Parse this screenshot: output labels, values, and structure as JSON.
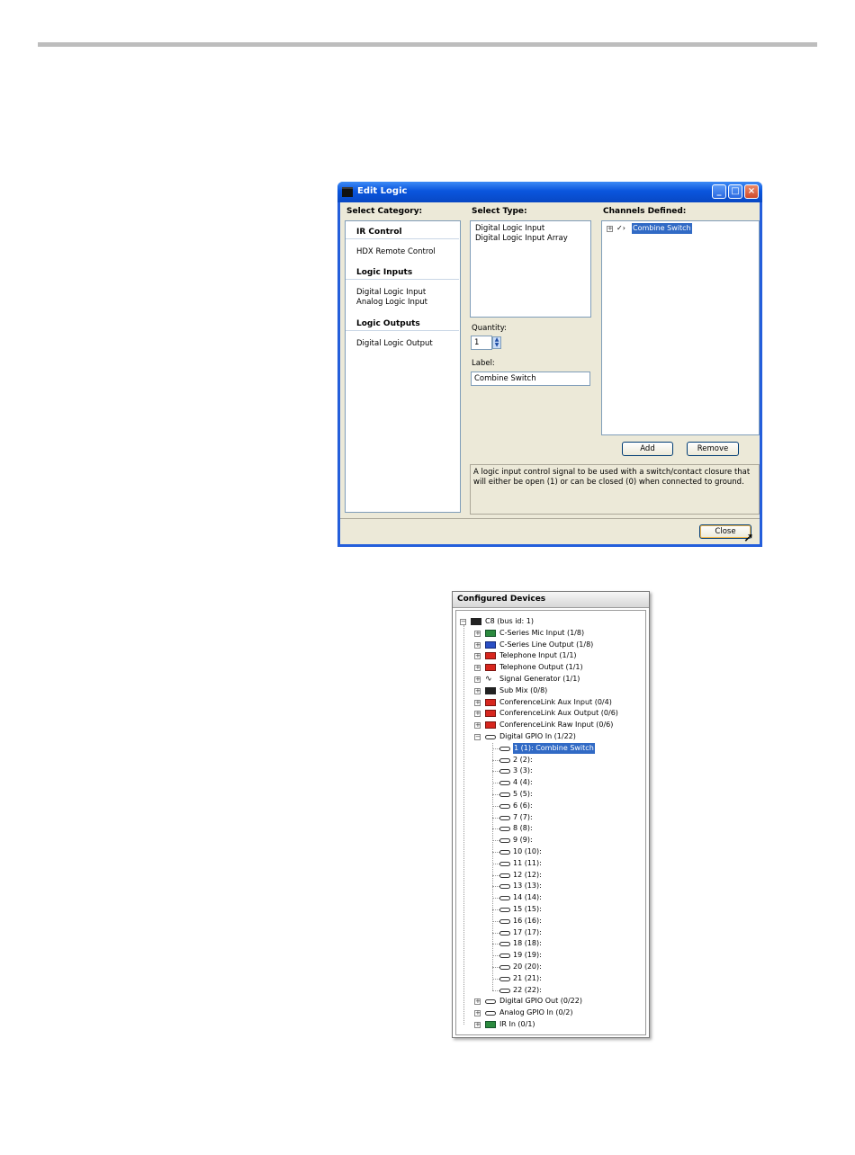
{
  "window": {
    "title": "Edit Logic",
    "headers": {
      "category": "Select Category:",
      "type": "Select Type:",
      "channels": "Channels Defined:"
    },
    "categories": [
      {
        "heading": "IR Control",
        "items": [
          "HDX Remote Control"
        ]
      },
      {
        "heading": "Logic Inputs",
        "items": [
          "Digital Logic Input",
          "Analog Logic Input"
        ]
      },
      {
        "heading": "Logic Outputs",
        "items": [
          "Digital Logic Output"
        ]
      }
    ],
    "types": [
      "Digital Logic Input",
      "Digital Logic Input Array"
    ],
    "quantity_label": "Quantity:",
    "quantity_value": "1",
    "label_label": "Label:",
    "label_value": "Combine Switch",
    "channel_item": "Combine Switch",
    "add_label": "Add",
    "remove_label": "Remove",
    "description": "A logic input control signal to be used with a switch/contact closure that will either be open (1) or can be closed (0) when connected to ground.",
    "close_label": "Close"
  },
  "devices": {
    "title": "Configured Devices",
    "root": "C8 (bus id: 1)",
    "items": [
      {
        "label": "C-Series Mic Input (1/8)",
        "icon": "green"
      },
      {
        "label": "C-Series Line Output (1/8)",
        "icon": "blue"
      },
      {
        "label": "Telephone Input (1/1)",
        "icon": "red"
      },
      {
        "label": "Telephone Output (1/1)",
        "icon": "red"
      },
      {
        "label": "Signal Generator (1/1)",
        "icon": "wave"
      },
      {
        "label": "Sub Mix (0/8)",
        "icon": "dark"
      },
      {
        "label": "ConferenceLink Aux Input (0/4)",
        "icon": "red"
      },
      {
        "label": "ConferenceLink Aux Output (0/6)",
        "icon": "red"
      },
      {
        "label": "ConferenceLink Raw Input (0/6)",
        "icon": "red"
      },
      {
        "label": "Digital GPIO In (1/22)",
        "icon": "gpio"
      }
    ],
    "gpio_children": [
      "1 (1): Combine Switch",
      "2 (2):",
      "3 (3):",
      "4 (4):",
      "5 (5):",
      "6 (6):",
      "7 (7):",
      "8 (8):",
      "9 (9):",
      "10 (10):",
      "11 (11):",
      "12 (12):",
      "13 (13):",
      "14 (14):",
      "15 (15):",
      "16 (16):",
      "17 (17):",
      "18 (18):",
      "19 (19):",
      "20 (20):",
      "21 (21):",
      "22 (22):"
    ],
    "after_items": [
      {
        "label": "Digital GPIO Out (0/22)",
        "icon": "gpio"
      },
      {
        "label": "Analog GPIO In (0/2)",
        "icon": "gpio"
      },
      {
        "label": "IR In (0/1)",
        "icon": "green"
      }
    ]
  }
}
